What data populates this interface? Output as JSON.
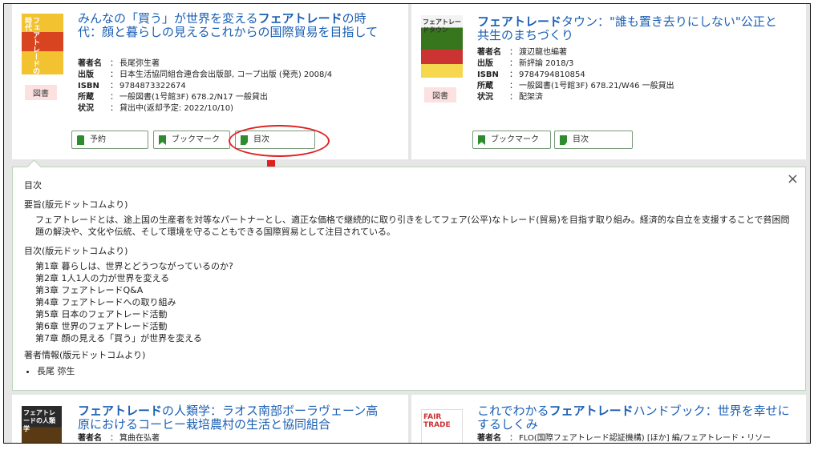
{
  "books": [
    {
      "title_parts": [
        "みんなの「買う」が世界を変える",
        "フェアトレード",
        "の時代：顔と暮らしの見えるこれからの国際貿易を目指して"
      ],
      "cover_text": "フェアトレードの時代",
      "badge": "図書",
      "meta": [
        {
          "k": "著者名",
          "v": "長尾弥生著"
        },
        {
          "k": "出版",
          "v": "日本生活協同組合連合会出版部, コープ出版 (発売) 2008/4"
        },
        {
          "k": "ISBN",
          "v": "9784873322674"
        },
        {
          "k": "所蔵",
          "v": "一般図書(1号館3F) 678.2/N17 一般貸出"
        },
        {
          "k": "状況",
          "v": "貸出中(返却予定: 2022/10/10)"
        }
      ],
      "buttons": [
        "予約",
        "ブックマーク",
        "目次"
      ]
    },
    {
      "title_parts": [
        "",
        "フェアトレード",
        "タウン：\"誰も置き去りにしない\"公正と共生のまちづくり"
      ],
      "cover_text": "フェアトレードタウン",
      "badge": "図書",
      "meta": [
        {
          "k": "著者名",
          "v": "渡辺龍也編著"
        },
        {
          "k": "出版",
          "v": "新評論 2018/3"
        },
        {
          "k": "ISBN",
          "v": "9784794810854"
        },
        {
          "k": "所蔵",
          "v": "一般図書(1号館3F) 678.21/W46 一般貸出"
        },
        {
          "k": "状況",
          "v": "配架済"
        }
      ],
      "buttons": [
        "ブックマーク",
        "目次"
      ]
    },
    {
      "title_parts": [
        "",
        "フェアトレード",
        "の人類学：ラオス南部ボーラヴェーン高原におけるコーヒー栽培農村の生活と協同組合"
      ],
      "cover_text": "フェアトレードの人類学",
      "meta": [
        {
          "k": "著者名",
          "v": "箕曲在弘著"
        }
      ]
    },
    {
      "title_parts": [
        "これでわかる",
        "フェアトレード",
        "ハンドブック：世界を幸せにするしくみ"
      ],
      "cover_text": "FAIR TRADE",
      "meta": [
        {
          "k": "著者名",
          "v": "FLO(国際フェアトレード認証機構) [ほか] 編/フェアトレード・リソー"
        }
      ]
    }
  ],
  "toc_panel": {
    "title": "目次",
    "summary_heading": "要旨(版元ドットコムより)",
    "summary": "フェアトレードとは、途上国の生産者を対等なパートナーとし、適正な価格で継続的に取り引きをしてフェア(公平)なトレード(貿易)を目指す取り組み。経済的な自立を支援することで貧困問題の解決や、文化や伝統、そして環境を守ることもできる国際貿易として注目されている。",
    "toc_heading": "目次(版元ドットコムより)",
    "chapters": [
      "第1章 暮らしは、世界とどうつながっているのか?",
      "第2章 1人1人の力が世界を変える",
      "第3章 フェアトレードQ&A",
      "第4章 フェアトレードへの取り組み",
      "第5章 日本のフェアトレード活動",
      "第6章 世界のフェアトレード活動",
      "第7章 顔の見える「買う」が世界を変える"
    ],
    "author_heading": "著者情報(版元ドットコムより)",
    "author": "長尾 弥生",
    "close": "×"
  },
  "colors": {
    "link": "#1a5fb4",
    "accent_green": "#2e8b2e",
    "annotation": "#e02020",
    "badge_bg": "#fde0e0"
  }
}
